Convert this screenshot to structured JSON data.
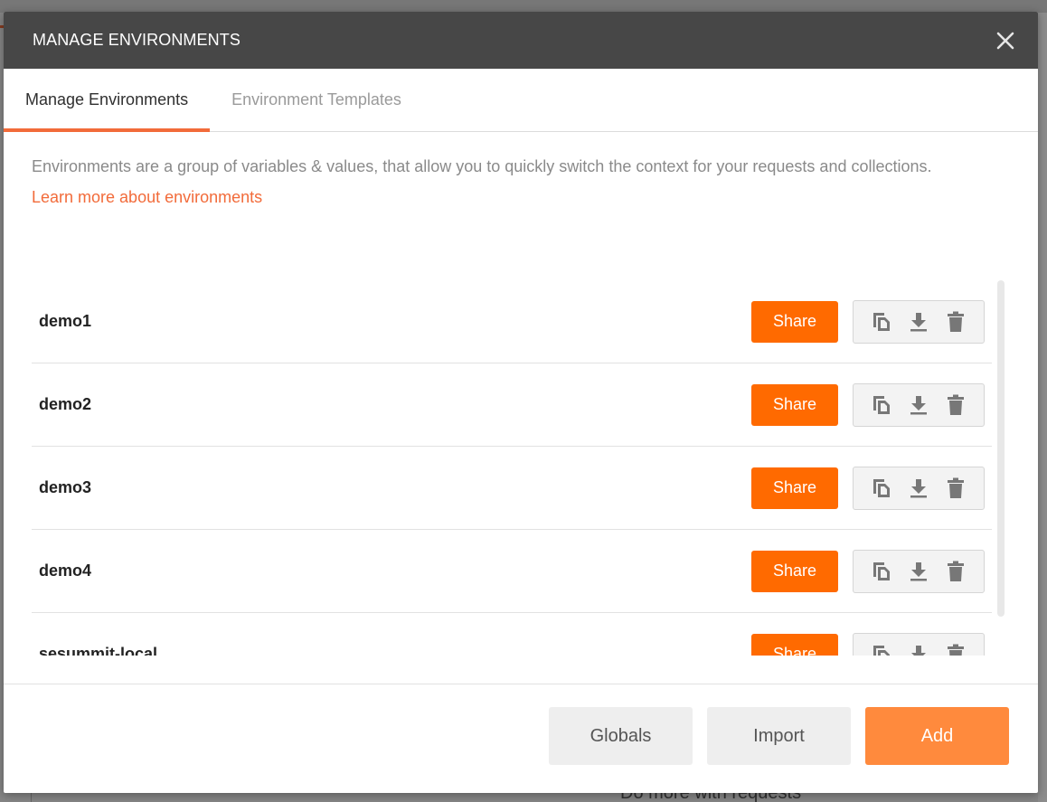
{
  "background": {
    "bottom_text": "Do more with requests"
  },
  "modal": {
    "title": "MANAGE ENVIRONMENTS",
    "close_icon": "close-icon",
    "tabs": [
      {
        "label": "Manage Environments",
        "active": true
      },
      {
        "label": "Environment Templates",
        "active": false
      }
    ],
    "description": "Environments are a group of variables & values, that allow you to quickly switch the context for your requests and collections.",
    "learn_more": "Learn more about environments",
    "environments": [
      {
        "name": "demo1",
        "share_label": "Share"
      },
      {
        "name": "demo2",
        "share_label": "Share"
      },
      {
        "name": "demo3",
        "share_label": "Share"
      },
      {
        "name": "demo4",
        "share_label": "Share"
      },
      {
        "name": "sesummit-local",
        "share_label": "Share"
      }
    ],
    "row_icons": [
      "duplicate-icon",
      "download-icon",
      "trash-icon"
    ],
    "footer": {
      "globals_label": "Globals",
      "import_label": "Import",
      "add_label": "Add"
    }
  },
  "colors": {
    "accent": "#ff6a00",
    "add_button": "#ff8a3d",
    "header": "#474747",
    "link": "#f26b3a"
  }
}
